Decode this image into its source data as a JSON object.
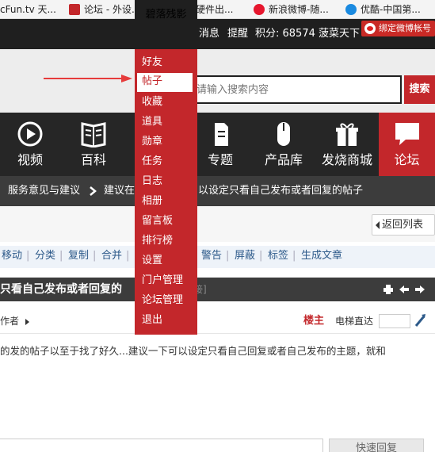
{
  "bookmarks": [
    {
      "label": "cFun.tv 天..."
    },
    {
      "label": "论坛 - 外设..."
    },
    {
      "label": "玩家硬件出..."
    },
    {
      "label": "新浪微博-随..."
    },
    {
      "label": "优酷-中国第..."
    }
  ],
  "topbar": {
    "username": "碧落残影",
    "messages": "消息",
    "reminders": "提醒",
    "points": "积分: 68574",
    "user2": "菠菜天下",
    "bind_weibo": "绑定微博帐号"
  },
  "search": {
    "placeholder": "请输入搜索内容",
    "button": "搜索"
  },
  "nav": {
    "items": [
      {
        "label": "视频",
        "icon": "play-icon"
      },
      {
        "label": "百科",
        "icon": "book-icon"
      },
      {
        "label": "专题",
        "icon": "document-icon"
      },
      {
        "label": "产品库",
        "icon": "mouse-icon"
      },
      {
        "label": "发烧商城",
        "icon": "gift-icon"
      },
      {
        "label": "论坛",
        "icon": "chat-bubble-icon"
      }
    ]
  },
  "breadcrumb": {
    "item1": "服务意见与建议",
    "item2": "建议在",
    "item2_rest": "以设定只看自己发布或者回复的帖子"
  },
  "return_button": "返回列表",
  "actions": [
    "移动",
    "分类",
    "复制",
    "合并",
    "警告",
    "屏蔽",
    "标签",
    "生成文章"
  ],
  "thread": {
    "title": "只看自己发布或者回复的",
    "copy_link": "接]"
  },
  "author_row": {
    "author_only": "作者",
    "floor_main": "楼主",
    "elevator": "电梯直达"
  },
  "post": {
    "body": "的发的帖子以至于找了好久...建议一下可以设定只看自己回复或者自己发布的主题，就和"
  },
  "reply": {
    "fast_reply": "快速回复"
  },
  "dropdown": {
    "items": [
      "好友",
      "帖子",
      "收藏",
      "道具",
      "勋章",
      "任务",
      "日志",
      "相册",
      "留言板",
      "排行榜",
      "设置",
      "门户管理",
      "论坛管理",
      "退出"
    ],
    "active_index": 1
  },
  "colors": {
    "brand_red": "#c3272b",
    "dark_bar": "#1f1f1f",
    "link_blue": "#2d5a8a"
  }
}
